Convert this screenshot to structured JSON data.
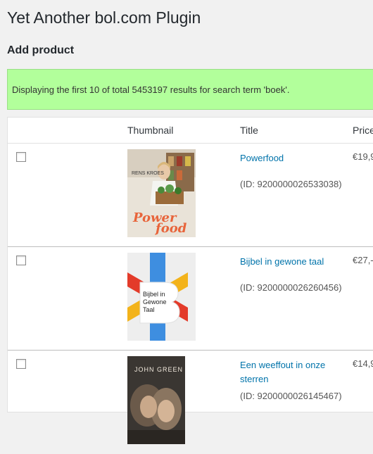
{
  "page": {
    "title": "Yet Another bol.com Plugin",
    "subtitle": "Add product"
  },
  "notice": {
    "text": "Displaying the first 10 of total 5453197 results for search term 'boek'."
  },
  "table": {
    "columns": [
      "",
      "Thumbnail",
      "Title",
      "Price"
    ],
    "rows": [
      {
        "title": "Powerfood",
        "id_text": "(ID: 9200000026533038)",
        "price": "€19,9",
        "checked": false,
        "cover": {
          "line1": "Power",
          "line2": "food",
          "author": "RENS KROES"
        }
      },
      {
        "title": "Bijbel in gewone taal",
        "id_text": "(ID: 9200000026260456)",
        "price": "€27,-",
        "checked": false,
        "cover": {
          "line1": "Bijbel in",
          "line2": "Gewone",
          "line3": "Taal"
        }
      },
      {
        "title": "Een weeffout in onze sterren",
        "id_text": "(ID: 9200000026145467)",
        "price": "€14,9",
        "checked": false,
        "cover": {
          "author": "JOHN GREEN"
        }
      }
    ]
  },
  "colors": {
    "notice_bg": "#b2ff9b",
    "link": "#0073aa"
  }
}
